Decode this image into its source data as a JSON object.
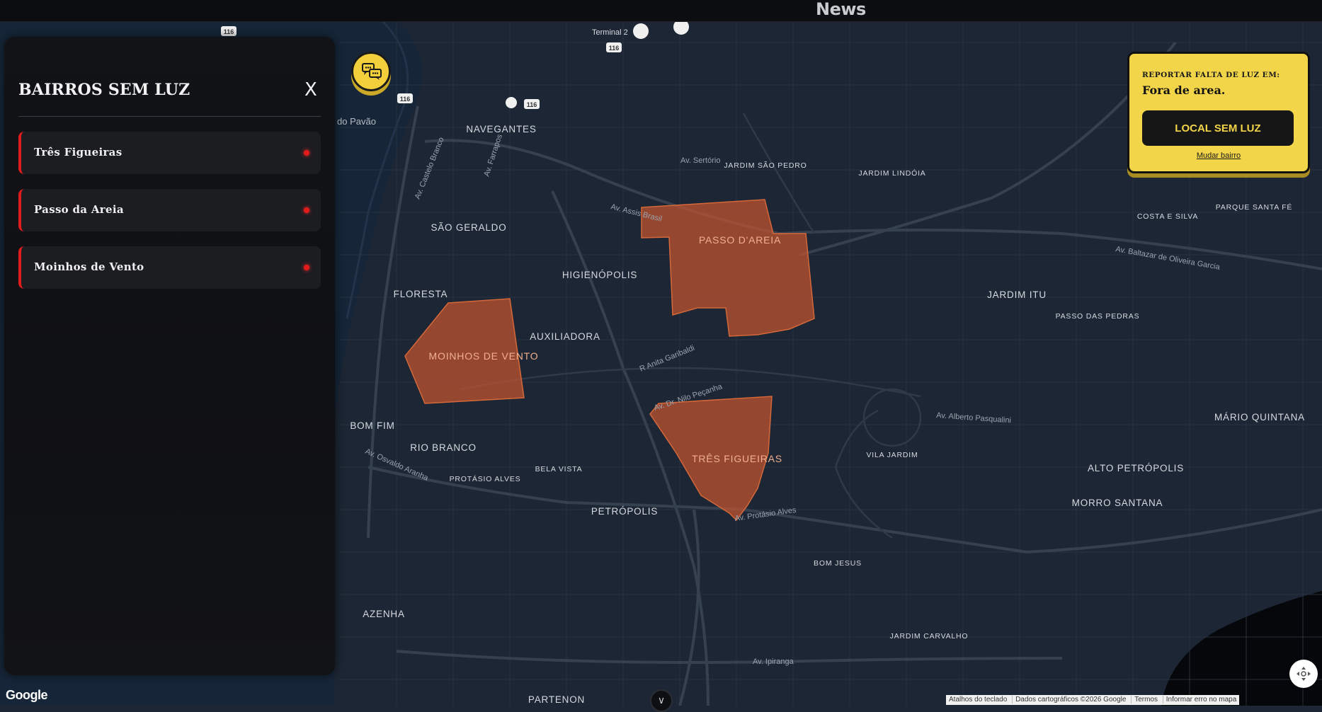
{
  "top_bar": {
    "title": "News"
  },
  "panel": {
    "title": "BAIRROS SEM LUZ",
    "close_label": "X",
    "items": [
      {
        "label": "Três Figueiras"
      },
      {
        "label": "Passo da Areia"
      },
      {
        "label": "Moinhos de Vento"
      }
    ]
  },
  "report": {
    "label": "REPORTAR FALTA DE LUZ EM:",
    "status": "Fora de area.",
    "button_label": "LOCAL SEM LUZ",
    "link_label": "Mudar bairro"
  },
  "map": {
    "neighborhood_labels": [
      "NAVEGANTES",
      "SÃO GERALDO",
      "HIGIENÓPOLIS",
      "FLORESTA",
      "AUXILIADORA",
      "BOM FIM",
      "RIO BRANCO",
      "PROTÁSIO ALVES",
      "BELA VISTA",
      "PETRÓPOLIS",
      "AZENHA",
      "PARTENON",
      "JARDIM SÃO PEDRO",
      "JARDIM LINDÓIA",
      "JARDIM ITU",
      "PASSO DAS PEDRAS",
      "VILA JARDIM",
      "BOM JESUS",
      "JARDIM CARVALHO",
      "COSTA E SILVA",
      "PARQUE SANTA FÉ",
      "ALTO PETRÓPOLIS",
      "MORRO SANTANA",
      "MÁRIO QUINTANA"
    ],
    "outage_labels": [
      "PASSO D'AREIA",
      "MOINHOS DE VENTO",
      "TRÊS FIGUEIRAS"
    ],
    "street_labels": [
      "Av. Sertório",
      "Av. Assis Brasil",
      "R Anita Garibaldi",
      "Av. Dr. Nilo Peçanha",
      "Av. Protásio Alves",
      "Av. Alberto Pasqualini",
      "Av. Ipiranga",
      "Av. Castelo Branco",
      "Av. Farrapos",
      "Av. Osvaldo Aranha",
      "Av. Baltazar de Oliveira Garcia",
      "Terminal 2",
      "do Pavão"
    ],
    "highway_badges": [
      "116",
      "116",
      "116",
      "116"
    ],
    "colors": {
      "background": "#1d2634",
      "outage_fill": "#c4552f",
      "road": "#2f3a4b",
      "label": "#d6dae0"
    }
  },
  "footer": {
    "google_logo": "Google",
    "attribution": [
      "Atalhos do teclado",
      "Dados cartográficos ©2026 Google",
      "Termos",
      "Informar erro no mapa"
    ]
  },
  "icons": {
    "chat": "chat-bubbles-icon",
    "locate": "locate-icon",
    "chevron": "chevron-down-icon"
  }
}
